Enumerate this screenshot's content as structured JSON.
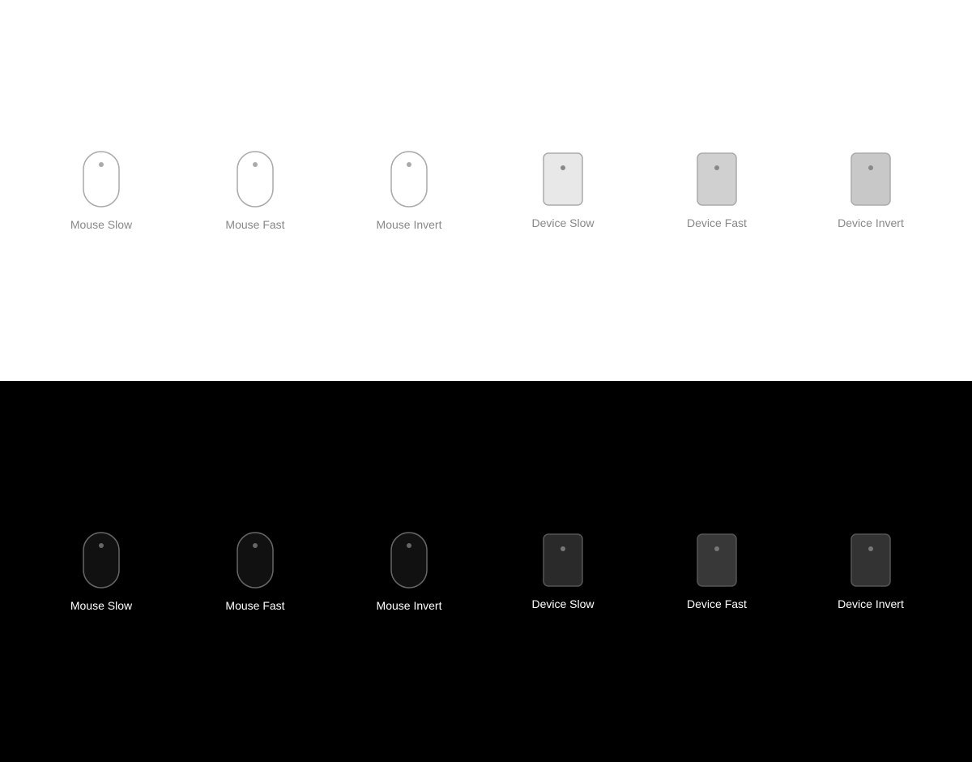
{
  "top": {
    "bg": "#ffffff",
    "items": [
      {
        "id": "mouse-slow",
        "label": "Mouse Slow",
        "type": "mouse",
        "variant": "slow",
        "theme": "light"
      },
      {
        "id": "mouse-fast",
        "label": "Mouse Fast",
        "type": "mouse",
        "variant": "fast",
        "theme": "light"
      },
      {
        "id": "mouse-invert",
        "label": "Mouse Invert",
        "type": "mouse",
        "variant": "invert",
        "theme": "light"
      },
      {
        "id": "device-slow",
        "label": "Device Slow",
        "type": "device",
        "variant": "slow",
        "theme": "light"
      },
      {
        "id": "device-fast",
        "label": "Device Fast",
        "type": "device",
        "variant": "fast",
        "theme": "light"
      },
      {
        "id": "device-invert",
        "label": "Device Invert",
        "type": "device",
        "variant": "invert",
        "theme": "light"
      }
    ]
  },
  "bottom": {
    "bg": "#000000",
    "items": [
      {
        "id": "mouse-slow-dark",
        "label": "Mouse Slow",
        "type": "mouse",
        "variant": "slow",
        "theme": "dark"
      },
      {
        "id": "mouse-fast-dark",
        "label": "Mouse Fast",
        "type": "mouse",
        "variant": "fast",
        "theme": "dark"
      },
      {
        "id": "mouse-invert-dark",
        "label": "Mouse Invert",
        "type": "mouse",
        "variant": "invert",
        "theme": "dark"
      },
      {
        "id": "device-slow-dark",
        "label": "Device Slow",
        "type": "device",
        "variant": "slow",
        "theme": "dark"
      },
      {
        "id": "device-fast-dark",
        "label": "Device Fast",
        "type": "device",
        "variant": "fast",
        "theme": "dark"
      },
      {
        "id": "device-invert-dark",
        "label": "Device Invert",
        "type": "device",
        "variant": "invert",
        "theme": "dark"
      }
    ]
  }
}
